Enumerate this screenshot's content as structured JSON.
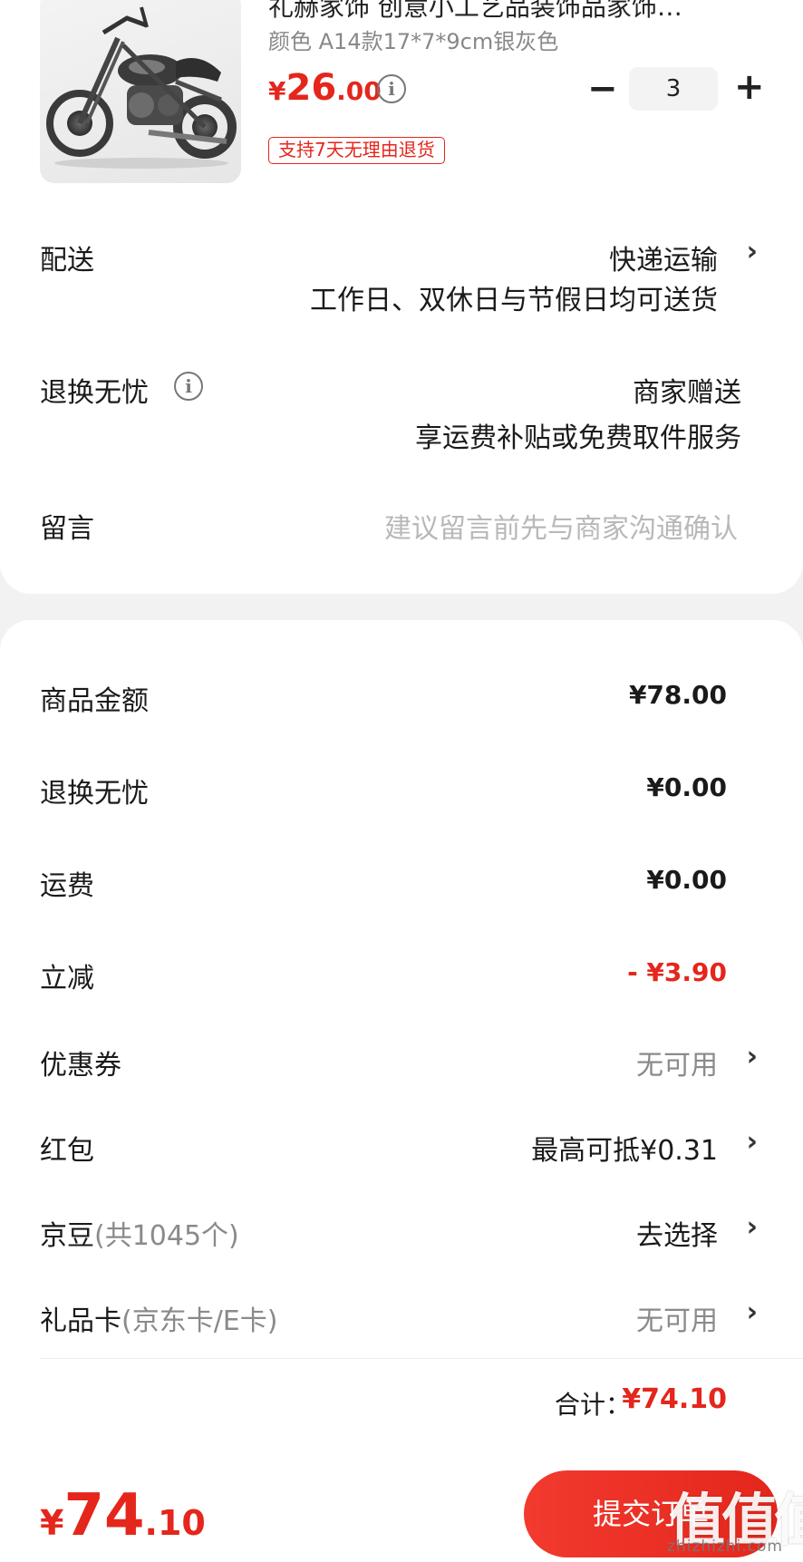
{
  "product": {
    "title": "礼赫家饰 创意小工艺品装饰品家饰…",
    "spec": "颜色 A14款17*7*9cm银灰色",
    "price_currency": "¥",
    "price_int": "26",
    "price_dec": ".00",
    "info_icon": "i",
    "minus": "−",
    "quantity": "3",
    "plus": "+",
    "badge": "支持7天无理由退货"
  },
  "delivery": {
    "label": "配送",
    "method": "快递运输",
    "note": "工作日、双休日与节假日均可送货",
    "chevron": "›"
  },
  "return_service": {
    "label": "退换无忧",
    "info_icon": "i",
    "value": "商家赠送",
    "note": "享运费补贴或免费取件服务"
  },
  "message": {
    "label": "留言",
    "placeholder": "建议留言前先与商家沟通确认"
  },
  "summary": {
    "goods_amount_label": "商品金额",
    "goods_amount": "¥78.00",
    "return_label": "退换无忧",
    "return_amount": "¥0.00",
    "shipping_label": "运费",
    "shipping_amount": "¥0.00",
    "discount_label": "立减",
    "discount_amount": "- ¥3.90",
    "coupon_label": "优惠券",
    "coupon_value": "无可用",
    "redpacket_label": "红包",
    "redpacket_value": "最高可抵¥0.31",
    "jingdou_label": "京豆",
    "jingdou_sub": "(共1045个)",
    "jingdou_value": "去选择",
    "giftcard_label": "礼品卡",
    "giftcard_sub": "(京东卡/E卡)",
    "giftcard_value": "无可用",
    "total_label": "合计：",
    "total_value": "¥74.10",
    "chevron": "›"
  },
  "bottom_bar": {
    "currency": "¥",
    "int": "74",
    "dec": ".10",
    "submit_label": "提交订单"
  },
  "watermark": {
    "logo": "值值值",
    "url": "zhizhizhi.com"
  },
  "colors": {
    "accent": "#e4261c",
    "background": "#f2f2f2"
  }
}
